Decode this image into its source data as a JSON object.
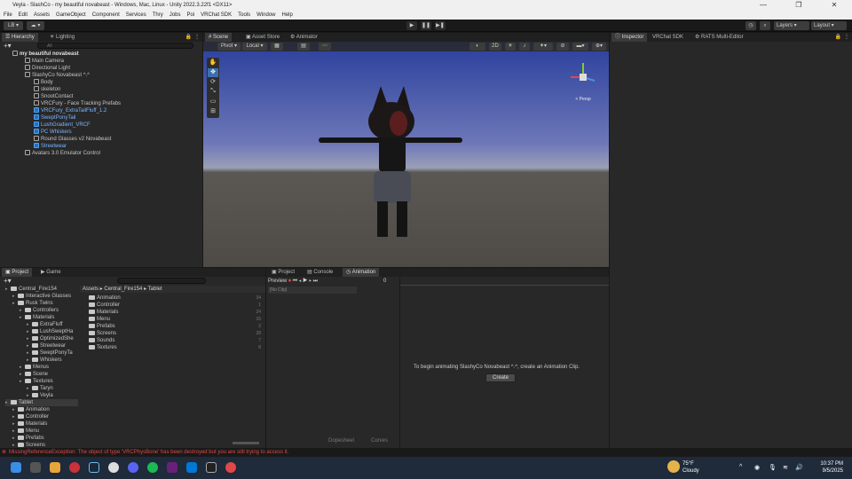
{
  "window": {
    "title": "Veyla - SlashCo - my beautiful novabeast - Windows, Mac, Linux - Unity 2022.3.22f1 <DX11>",
    "controls": [
      "—",
      "❐",
      "✕"
    ]
  },
  "menu": [
    "File",
    "Edit",
    "Assets",
    "GameObject",
    "Component",
    "Services",
    "Thry",
    "Jobs",
    "Poi",
    "VRChat SDK",
    "Tools",
    "Window",
    "Help"
  ],
  "toolbar": {
    "account": "LB",
    "layers": "Layers",
    "layout": "Layout"
  },
  "hierarchy": {
    "tabs": [
      "Hierarchy",
      "Lighting"
    ],
    "search_placeholder": "All",
    "items": [
      {
        "label": "my beautiful novabeast",
        "bold": true
      },
      {
        "label": "Main Camera"
      },
      {
        "label": "Directional Light"
      },
      {
        "label": "SlashyCo Novabeast ^.^"
      },
      {
        "label": "Body"
      },
      {
        "label": "skeleton"
      },
      {
        "label": "SnootContact"
      },
      {
        "label": "VRCFury - Face Tracking Prefabs"
      },
      {
        "label": "VRCFury_ExtraTailFluff_1.2",
        "blue": true
      },
      {
        "label": "SweptPonyTail",
        "blue": true
      },
      {
        "label": "LushGradient_VRCF",
        "blue": true
      },
      {
        "label": "PC Whiskers",
        "blue": true
      },
      {
        "label": "Round Glasses v2 Novabeast"
      },
      {
        "label": "Streetwear",
        "blue": true
      },
      {
        "label": "Avatars 3.0 Emulator Control"
      }
    ]
  },
  "scene": {
    "tabs": [
      "Scene",
      "Asset Store",
      "Animator"
    ],
    "pivot": "Pivot",
    "local": "Local",
    "mode_2d": "2D",
    "persp": "< Persp"
  },
  "inspector": {
    "tabs": [
      "Inspector",
      "VRChat SDK",
      "RATS Multi-Editor"
    ]
  },
  "project": {
    "tabs": [
      "Project",
      "Game"
    ],
    "breadcrumb": [
      "Assets",
      "Central_Fire154",
      "Tablet"
    ],
    "tree": [
      {
        "label": "Central_Fire154",
        "level": 0
      },
      {
        "label": "Interactive Glasses",
        "level": 1
      },
      {
        "label": "Rusk Twins",
        "level": 1
      },
      {
        "label": "Controllers",
        "level": 2
      },
      {
        "label": "Materials",
        "level": 2
      },
      {
        "label": "ExtraFluff",
        "level": 3
      },
      {
        "label": "LushSweptHa",
        "level": 3
      },
      {
        "label": "OptimizedShe",
        "level": 3
      },
      {
        "label": "Streetwear",
        "level": 3
      },
      {
        "label": "SweptPonyTa",
        "level": 3
      },
      {
        "label": "Whiskers",
        "level": 3
      },
      {
        "label": "Menus",
        "level": 2
      },
      {
        "label": "Scene",
        "level": 2
      },
      {
        "label": "Textures",
        "level": 2
      },
      {
        "label": "Taryn",
        "level": 3
      },
      {
        "label": "Veyla",
        "level": 3
      },
      {
        "label": "Tablet",
        "level": 0,
        "selected": true
      },
      {
        "label": "Animation",
        "level": 1
      },
      {
        "label": "Controller",
        "level": 1
      },
      {
        "label": "Materials",
        "level": 1
      },
      {
        "label": "Menu",
        "level": 1
      },
      {
        "label": "Prefabs",
        "level": 1
      },
      {
        "label": "Screens",
        "level": 1
      }
    ],
    "folders": [
      {
        "label": "Animation",
        "count": "34"
      },
      {
        "label": "Controller",
        "count": "1"
      },
      {
        "label": "Materials",
        "count": "24"
      },
      {
        "label": "Menu",
        "count": "15"
      },
      {
        "label": "Prefabs",
        "count": "2"
      },
      {
        "label": "Screens",
        "count": "28"
      },
      {
        "label": "Sounds",
        "count": "7"
      },
      {
        "label": "Textures",
        "count": "8"
      }
    ]
  },
  "animation": {
    "tabs": [
      "Project",
      "Console",
      "Animation"
    ],
    "preview": "Preview",
    "clip": "[No Clip]",
    "frame": "0",
    "message": "To begin animating SlashyCo Novabeast ^.^, create an Animation Clip.",
    "create": "Create",
    "bottom_tabs": [
      "Dopesheet",
      "Curves"
    ]
  },
  "status": {
    "error": "MissingReferenceException: The object of type 'VRCPhysBone' has been destroyed but you are still trying to access it."
  },
  "taskbar": {
    "weather_temp": "75°F",
    "weather_desc": "Cloudy",
    "time": "10:37 PM",
    "date": "9/5/2025"
  },
  "colors": {
    "accent_blue": "#4aa3ff",
    "error_red": "#e04848",
    "panel": "#282828"
  }
}
